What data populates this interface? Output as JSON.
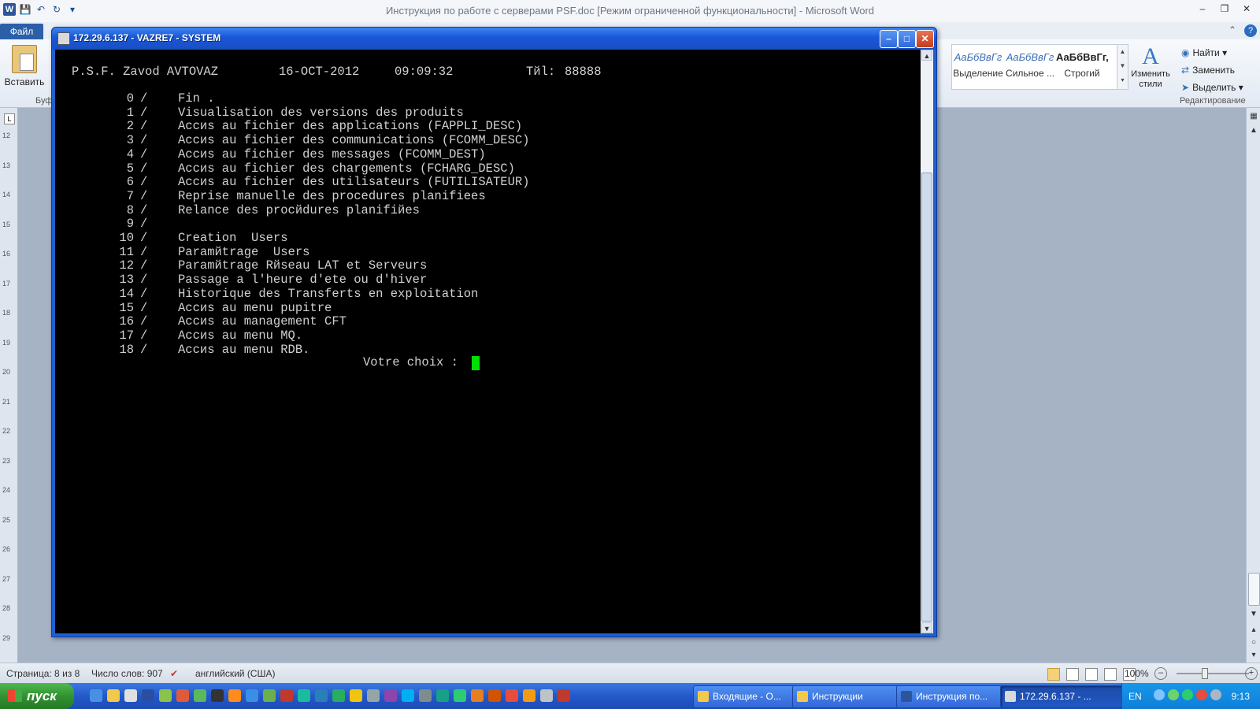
{
  "word": {
    "title": "Инструкция по работе с серверами PSF.doc [Режим ограниченной функциональности]  -  Microsoft Word",
    "file_tab": "Файл",
    "paste_label": "Вставить",
    "clipboard_group": "Буф",
    "styles": [
      {
        "sample": "АаБбВвГг",
        "name": "Выделение"
      },
      {
        "sample": "АаБбВвГг",
        "name": "Сильное ..."
      },
      {
        "sample": "АаБбВвГг,",
        "name": "Строгий"
      }
    ],
    "change_styles": "Изменить стили",
    "editing": {
      "find": "Найти",
      "replace": "Заменить",
      "select": "Выделить",
      "group_label": "Редактирование"
    },
    "status": {
      "page": "Страница: 8 из 8",
      "words": "Число слов: 907",
      "lang": "английский (США)",
      "zoom": "100%"
    },
    "ruler_numbers": [
      "12",
      "13",
      "14",
      "15",
      "16",
      "17",
      "18",
      "19",
      "20",
      "21",
      "22",
      "23",
      "24",
      "25",
      "26",
      "27",
      "28",
      "29"
    ]
  },
  "terminal": {
    "title": "172.29.6.137 - VAZRE7 - SYSTEM",
    "header": {
      "company": "P.S.F. Zavod AVTOVAZ",
      "date": "16-OCT-2012",
      "time": "09:09:32",
      "tel_label": "Тйl:",
      "tel_value": "88888"
    },
    "menu": [
      {
        "num": "0",
        "text": "Fin ."
      },
      {
        "num": "1",
        "text": "Visualisation des versions des produits"
      },
      {
        "num": "2",
        "text": "Accиs au fichier des applications (FAPPLI_DESC)"
      },
      {
        "num": "3",
        "text": "Accиs au fichier des communications (FCOMM_DESC)"
      },
      {
        "num": "4",
        "text": "Accиs au fichier des messages (FCOMM_DEST)"
      },
      {
        "num": "5",
        "text": "Accиs au fichier des chargements (FCHARG_DESC)"
      },
      {
        "num": "6",
        "text": "Accиs au fichier des utilisateurs (FUTILISATEUR)"
      },
      {
        "num": "7",
        "text": "Reprise manuelle des procedures planifiees"
      },
      {
        "num": "8",
        "text": "Relance des procйdures planifiйes"
      },
      {
        "num": "9",
        "text": ""
      },
      {
        "num": "10",
        "text": "Creation  Users"
      },
      {
        "num": "11",
        "text": "Paramйtrage  Users"
      },
      {
        "num": "12",
        "text": "Paramйtrage Rйseau LAT et Serveurs"
      },
      {
        "num": "13",
        "text": "Passage a l'heure d'ete ou d'hiver"
      },
      {
        "num": "14",
        "text": "Historique des Transferts en exploitation"
      },
      {
        "num": "15",
        "text": "Accиs au menu pupitre"
      },
      {
        "num": "16",
        "text": "Accиs au management CFT"
      },
      {
        "num": "17",
        "text": "Accиs au menu MQ."
      },
      {
        "num": "18",
        "text": "Accиs au menu RDB."
      }
    ],
    "prompt": "Votre choix :",
    "cursor_color": "#00e000"
  },
  "taskbar": {
    "start": "пуск",
    "tasks": [
      {
        "label": "Входящие - О...",
        "active": false
      },
      {
        "label": "Инструкции",
        "active": false
      },
      {
        "label": "Инструкция по...",
        "active": false
      },
      {
        "label": "172.29.6.137 - ...",
        "active": true
      }
    ],
    "lang": "EN",
    "clock": "9:13"
  }
}
